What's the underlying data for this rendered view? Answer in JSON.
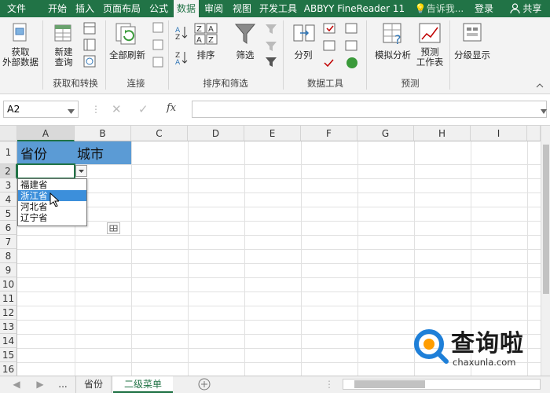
{
  "menu_tabs": [
    {
      "label": "文件"
    },
    {
      "label": "开始"
    },
    {
      "label": "插入"
    },
    {
      "label": "页面布局"
    },
    {
      "label": "公式"
    },
    {
      "label": "数据"
    },
    {
      "label": "审阅"
    },
    {
      "label": "视图"
    },
    {
      "label": "开发工具"
    },
    {
      "label": "ABBYY FineReader 11"
    }
  ],
  "tell_me": "告诉我...",
  "login": "登录",
  "share": "共享",
  "ribbon": {
    "get_external_data": [
      "获取",
      "外部数据"
    ],
    "new_query": [
      "新建",
      "查询"
    ],
    "refresh_all": "全部刷新",
    "sort": "排序",
    "filter": "筛选",
    "text_to_columns": "分列",
    "what_if": "模拟分析",
    "forecast": [
      "预测",
      "工作表"
    ],
    "outline": "分级显示",
    "groups": {
      "get_transform": "获取和转换",
      "connections": "连接",
      "sort_filter": "排序和筛选",
      "data_tools": "数据工具",
      "forecast": "预测"
    }
  },
  "name_box": "A2",
  "formula_fx": "fx",
  "columns": [
    "A",
    "B",
    "C",
    "D",
    "E",
    "F",
    "G",
    "H",
    "I"
  ],
  "rows": [
    "1",
    "2",
    "3",
    "4",
    "5",
    "6",
    "7",
    "8",
    "9",
    "10",
    "11",
    "12",
    "13",
    "14",
    "15",
    "16"
  ],
  "cells": {
    "A1": "省份",
    "B1": "城市"
  },
  "dropdown": {
    "options": [
      "福建省",
      "浙江省",
      "河北省",
      "辽宁省"
    ],
    "highlighted": "浙江省"
  },
  "sheets": {
    "more": "...",
    "tab1": "省份",
    "tab2": "二级菜单"
  },
  "watermark": {
    "text": "查询啦",
    "url": "chaxunla.com"
  },
  "colors": {
    "excel_green": "#217346",
    "header_fill": "#5b9bd5",
    "highlight": "#3c8fdb"
  }
}
